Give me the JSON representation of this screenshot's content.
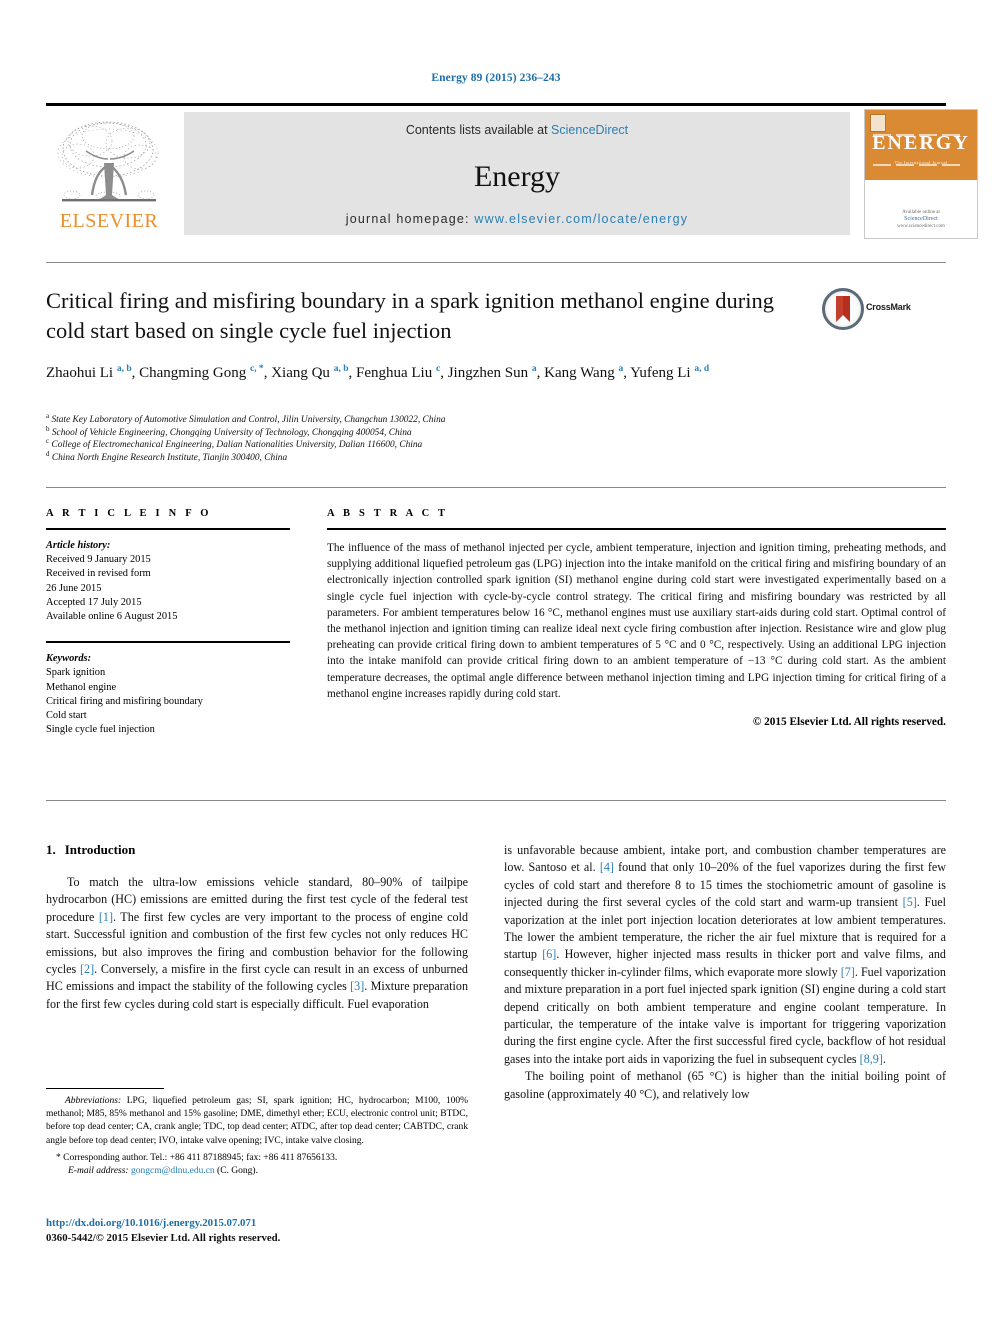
{
  "running_head": "Energy 89 (2015) 236–243",
  "masthead": {
    "publisher_logo_name": "elsevier-tree-logo",
    "publisher_wordmark": "ELSEVIER",
    "contents_line_prefix": "Contents lists available at ",
    "contents_line_link": "ScienceDirect",
    "journal_name": "Energy",
    "homepage_label": "journal homepage: ",
    "homepage_url": "www.elsevier.com/locate/energy",
    "cover": {
      "title": "ENERGY",
      "subtitle": "The International Journal",
      "footer_line1": "Available online at",
      "footer_line2": "ScienceDirect",
      "footer_line3": "www.sciencedirect.com"
    }
  },
  "article": {
    "title": "Critical firing and misfiring boundary in a spark ignition methanol engine during cold start based on single cycle fuel injection",
    "crossmark_label": "CrossMark",
    "authors_line1": "Zhaohui Li",
    "authors": [
      {
        "name": "Zhaohui Li",
        "sup": "a, b"
      },
      {
        "name": "Changming Gong",
        "sup": "c, *"
      },
      {
        "name": "Xiang Qu",
        "sup": "a, b"
      },
      {
        "name": "Fenghua Liu",
        "sup": "c"
      },
      {
        "name": "Jingzhen Sun",
        "sup": "a"
      },
      {
        "name": "Kang Wang",
        "sup": "a"
      },
      {
        "name": "Yufeng Li",
        "sup": "a, d"
      }
    ],
    "affiliations": [
      {
        "marker": "a",
        "text": "State Key Laboratory of Automotive Simulation and Control, Jilin University, Changchun 130022, China"
      },
      {
        "marker": "b",
        "text": "School of Vehicle Engineering, Chongqing University of Technology, Chongqing 400054, China"
      },
      {
        "marker": "c",
        "text": "College of Electromechanical Engineering, Dalian Nationalities University, Dalian 116600, China"
      },
      {
        "marker": "d",
        "text": "China North Engine Research Institute, Tianjin 300400, China"
      }
    ]
  },
  "article_info": {
    "heading": "A R T I C L E   I N F O",
    "history_label": "Article history:",
    "history": [
      "Received 9 January 2015",
      "Received in revised form",
      "26 June 2015",
      "Accepted 17 July 2015",
      "Available online 6 August 2015"
    ],
    "keywords_label": "Keywords:",
    "keywords": [
      "Spark ignition",
      "Methanol engine",
      "Critical firing and misfiring boundary",
      "Cold start",
      "Single cycle fuel injection"
    ]
  },
  "abstract": {
    "heading": "A B S T R A C T",
    "text": "The influence of the mass of methanol injected per cycle, ambient temperature, injection and ignition timing, preheating methods, and supplying additional liquefied petroleum gas (LPG) injection into the intake manifold on the critical firing and misfiring boundary of an electronically injection controlled spark ignition (SI) methanol engine during cold start were investigated experimentally based on a single cycle fuel injection with cycle-by-cycle control strategy. The critical firing and misfiring boundary was restricted by all parameters. For ambient temperatures below 16 °C, methanol engines must use auxiliary start-aids during cold start. Optimal control of the methanol injection and ignition timing can realize ideal next cycle firing combustion after injection. Resistance wire and glow plug preheating can provide critical firing down to ambient temperatures of 5 °C and 0 °C, respectively. Using an additional LPG injection into the intake manifold can provide critical firing down to an ambient temperature of −13 °C during cold start. As the ambient temperature decreases, the optimal angle difference between methanol injection timing and LPG injection timing for critical firing of a methanol engine increases rapidly during cold start.",
    "copyright": "© 2015 Elsevier Ltd. All rights reserved."
  },
  "body": {
    "section_number": "1.",
    "section_title": "Introduction",
    "left_paragraph_parts": [
      "To match the ultra-low emissions vehicle standard, 80–90% of tailpipe hydrocarbon (HC) emissions are emitted during the first test cycle of the federal test procedure ",
      "[1]",
      ". The first few cycles are very important to the process of engine cold start. Successful ignition and combustion of the first few cycles not only reduces HC emissions, but also improves the firing and combustion behavior for the following cycles ",
      "[2]",
      ". Conversely, a misfire in the first cycle can result in an excess of unburned HC emissions and impact the stability of the following cycles ",
      "[3]",
      ". Mixture preparation for the first few cycles during cold start is especially difficult. Fuel evaporation"
    ],
    "right_paragraph_parts": [
      "is unfavorable because ambient, intake port, and combustion chamber temperatures are low. Santoso et al. ",
      "[4]",
      " found that only 10–20% of the fuel vaporizes during the first few cycles of cold start and therefore 8 to 15 times the stochiometric amount of gasoline is injected during the first several cycles of the cold start and warm-up transient ",
      "[5]",
      ". Fuel vaporization at the inlet port injection location deteriorates at low ambient temperatures. The lower the ambient temperature, the richer the air fuel mixture that is required for a startup ",
      "[6]",
      ". However, higher injected mass results in thicker port and valve films, and consequently thicker in-cylinder films, which evaporate more slowly ",
      "[7]",
      ". Fuel vaporization and mixture preparation in a port fuel injected spark ignition (SI) engine during a cold start depend critically on both ambient temperature and engine coolant temperature. In particular, the temperature of the intake valve is important for triggering vaporization during the first engine cycle. After the first successful fired cycle, backflow of hot residual gases into the intake port aids in vaporizing the fuel in subsequent cycles ",
      "[8,9]",
      "."
    ],
    "right_paragraph2_parts": [
      "The boiling point of methanol (65 °C) is higher than the initial boiling point of gasoline (approximately 40 °C), and relatively low"
    ]
  },
  "footnotes": {
    "abbrev_lead": "Abbreviations:",
    "abbrev_text": " LPG, liquefied petroleum gas; SI, spark ignition; HC, hydrocarbon; M100, 100% methanol; M85, 85% methanol and 15% gasoline; DME, dimethyl ether; ECU, electronic control unit; BTDC, before top dead center; CA, crank angle; TDC, top dead center; ATDC, after top dead center; CABTDC, crank angle before top dead center; IVO, intake valve opening; IVC, intake valve closing.",
    "corresponding": "* Corresponding author. Tel.: +86 411 87188945; fax: +86 411 87656133.",
    "email_lead": "E-mail address:",
    "email_address": "gongcm@dlnu.edu.cn",
    "email_suffix": " (C. Gong)."
  },
  "page_footer": {
    "doi": "http://dx.doi.org/10.1016/j.energy.2015.07.071",
    "issn_line": "0360-5442/© 2015 Elsevier Ltd. All rights reserved."
  },
  "colors": {
    "link_blue": "#2a7fb5",
    "header_blue": "#1b6ea8",
    "elsevier_orange": "#ea8f30",
    "band_gray": "#e3e3e3",
    "cover_orange": "#d98a33"
  }
}
